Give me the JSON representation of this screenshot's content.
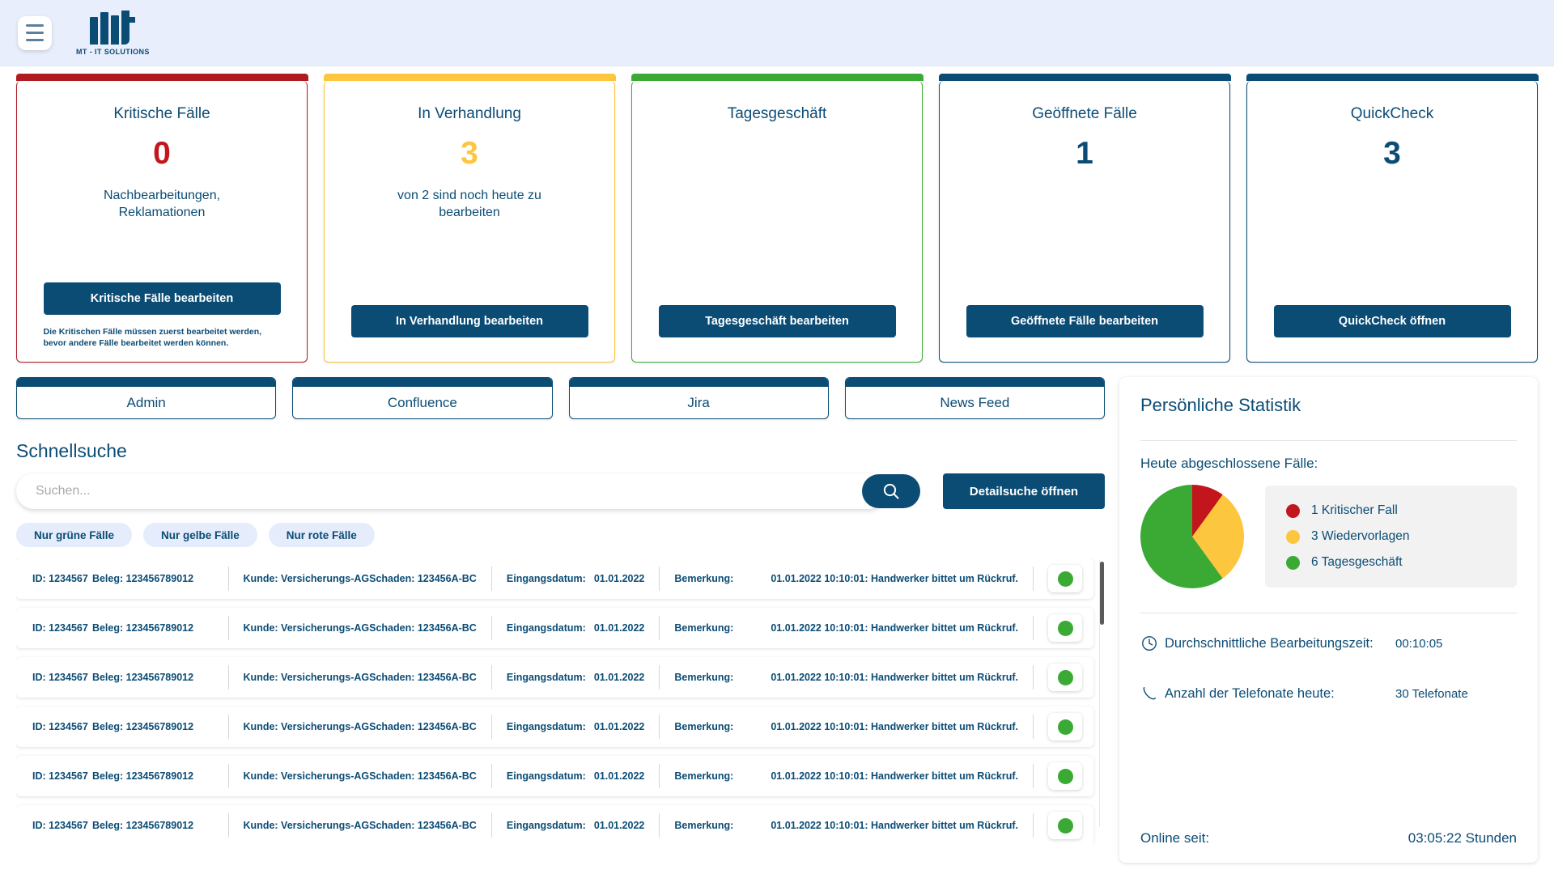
{
  "header": {
    "menu_label": "menu",
    "logo_text": "MT - IT SOLUTIONS"
  },
  "cards": [
    {
      "title": "Kritische Fälle",
      "number": "0",
      "subtitle": "Nachbearbeitungen, Reklamationen",
      "button": "Kritische Fälle bearbeiten",
      "note": "Die Kritischen Fälle müssen zuerst bearbeitet werden, bevor andere Fälle bearbeitet werden können.",
      "accent": "#b01b22"
    },
    {
      "title": "In Verhandlung",
      "number": "3",
      "subtitle": "von 2 sind noch heute zu bearbeiten",
      "button": "In Verhandlung bearbeiten",
      "note": "",
      "accent": "#fcc63f"
    },
    {
      "title": "Tagesgeschäft",
      "number": "",
      "subtitle": "",
      "button": "Tagesgeschäft bearbeiten",
      "note": "",
      "accent": "#3aaa35"
    },
    {
      "title": "Geöffnete Fälle",
      "number": "1",
      "subtitle": "",
      "button": "Geöffnete Fälle bearbeiten",
      "note": "",
      "accent": "#0b4c75"
    },
    {
      "title": "QuickCheck",
      "number": "3",
      "subtitle": "",
      "button": "QuickCheck öffnen",
      "note": "",
      "accent": "#0b4c75"
    }
  ],
  "nav": {
    "items": [
      {
        "label": "Admin"
      },
      {
        "label": "Confluence"
      },
      {
        "label": "Jira"
      },
      {
        "label": "News Feed"
      }
    ]
  },
  "search": {
    "heading": "Schnellsuche",
    "placeholder": "Suchen...",
    "value": "",
    "search_icon": "search-icon",
    "detail_button": "Detailsuche öffnen",
    "chips": [
      {
        "label": "Nur grüne Fälle"
      },
      {
        "label": "Nur gelbe Fälle"
      },
      {
        "label": "Nur rote Fälle"
      }
    ]
  },
  "results": {
    "labels": {
      "id": "ID:",
      "beleg": "Beleg:",
      "kunde": "Kunde:",
      "schaden": "Schaden:",
      "eingang": "Eingangsdatum:",
      "bemerkung": "Bemerkung:"
    },
    "rows": [
      {
        "id": "1234567",
        "beleg": "123456789012",
        "kunde": "Versicherungs-AG",
        "schaden": "123456A-BC",
        "eingang": "01.01.2022",
        "bemerkung": "01.01.2022 10:10:01: Handwerker bittet um Rückruf.",
        "status": "green"
      },
      {
        "id": "1234567",
        "beleg": "123456789012",
        "kunde": "Versicherungs-AG",
        "schaden": "123456A-BC",
        "eingang": "01.01.2022",
        "bemerkung": "01.01.2022 10:10:01: Handwerker bittet um Rückruf.",
        "status": "green"
      },
      {
        "id": "1234567",
        "beleg": "123456789012",
        "kunde": "Versicherungs-AG",
        "schaden": "123456A-BC",
        "eingang": "01.01.2022",
        "bemerkung": "01.01.2022 10:10:01: Handwerker bittet um Rückruf.",
        "status": "green"
      },
      {
        "id": "1234567",
        "beleg": "123456789012",
        "kunde": "Versicherungs-AG",
        "schaden": "123456A-BC",
        "eingang": "01.01.2022",
        "bemerkung": "01.01.2022 10:10:01: Handwerker bittet um Rückruf.",
        "status": "green"
      },
      {
        "id": "1234567",
        "beleg": "123456789012",
        "kunde": "Versicherungs-AG",
        "schaden": "123456A-BC",
        "eingang": "01.01.2022",
        "bemerkung": "01.01.2022 10:10:01: Handwerker bittet um Rückruf.",
        "status": "green"
      },
      {
        "id": "1234567",
        "beleg": "123456789012",
        "kunde": "Versicherungs-AG",
        "schaden": "123456A-BC",
        "eingang": "01.01.2022",
        "bemerkung": "01.01.2022 10:10:01: Handwerker bittet um Rückruf.",
        "status": "green"
      }
    ]
  },
  "stats": {
    "title": "Persönliche Statistik",
    "pie_heading": "Heute abgeschlossene Fälle:",
    "avg_time_label": "Durchschnittliche Bearbeitungszeit:",
    "avg_time_value": "00:10:05",
    "calls_label": "Anzahl der Telefonate heute:",
    "calls_value": "30 Telefonate",
    "online_label": "Online seit:",
    "online_value": "03:05:22 Stunden"
  },
  "chart_data": {
    "type": "pie",
    "title": "Heute abgeschlossene Fälle:",
    "categories": [
      "1 Kritischer Fall",
      "3 Wiedervorlagen",
      "6 Tagesgeschäft"
    ],
    "values": [
      1,
      3,
      6
    ],
    "colors": [
      "#c3161c",
      "#fcc63f",
      "#3aaa35"
    ],
    "total": 10,
    "legend_position": "right",
    "labels": [
      {
        "text": "1 Kritischer Fall",
        "color": "#c3161c"
      },
      {
        "text": "3 Wiedervorlagen",
        "color": "#fcc63f"
      },
      {
        "text": "6 Tagesgeschäft",
        "color": "#3aaa35"
      }
    ]
  }
}
